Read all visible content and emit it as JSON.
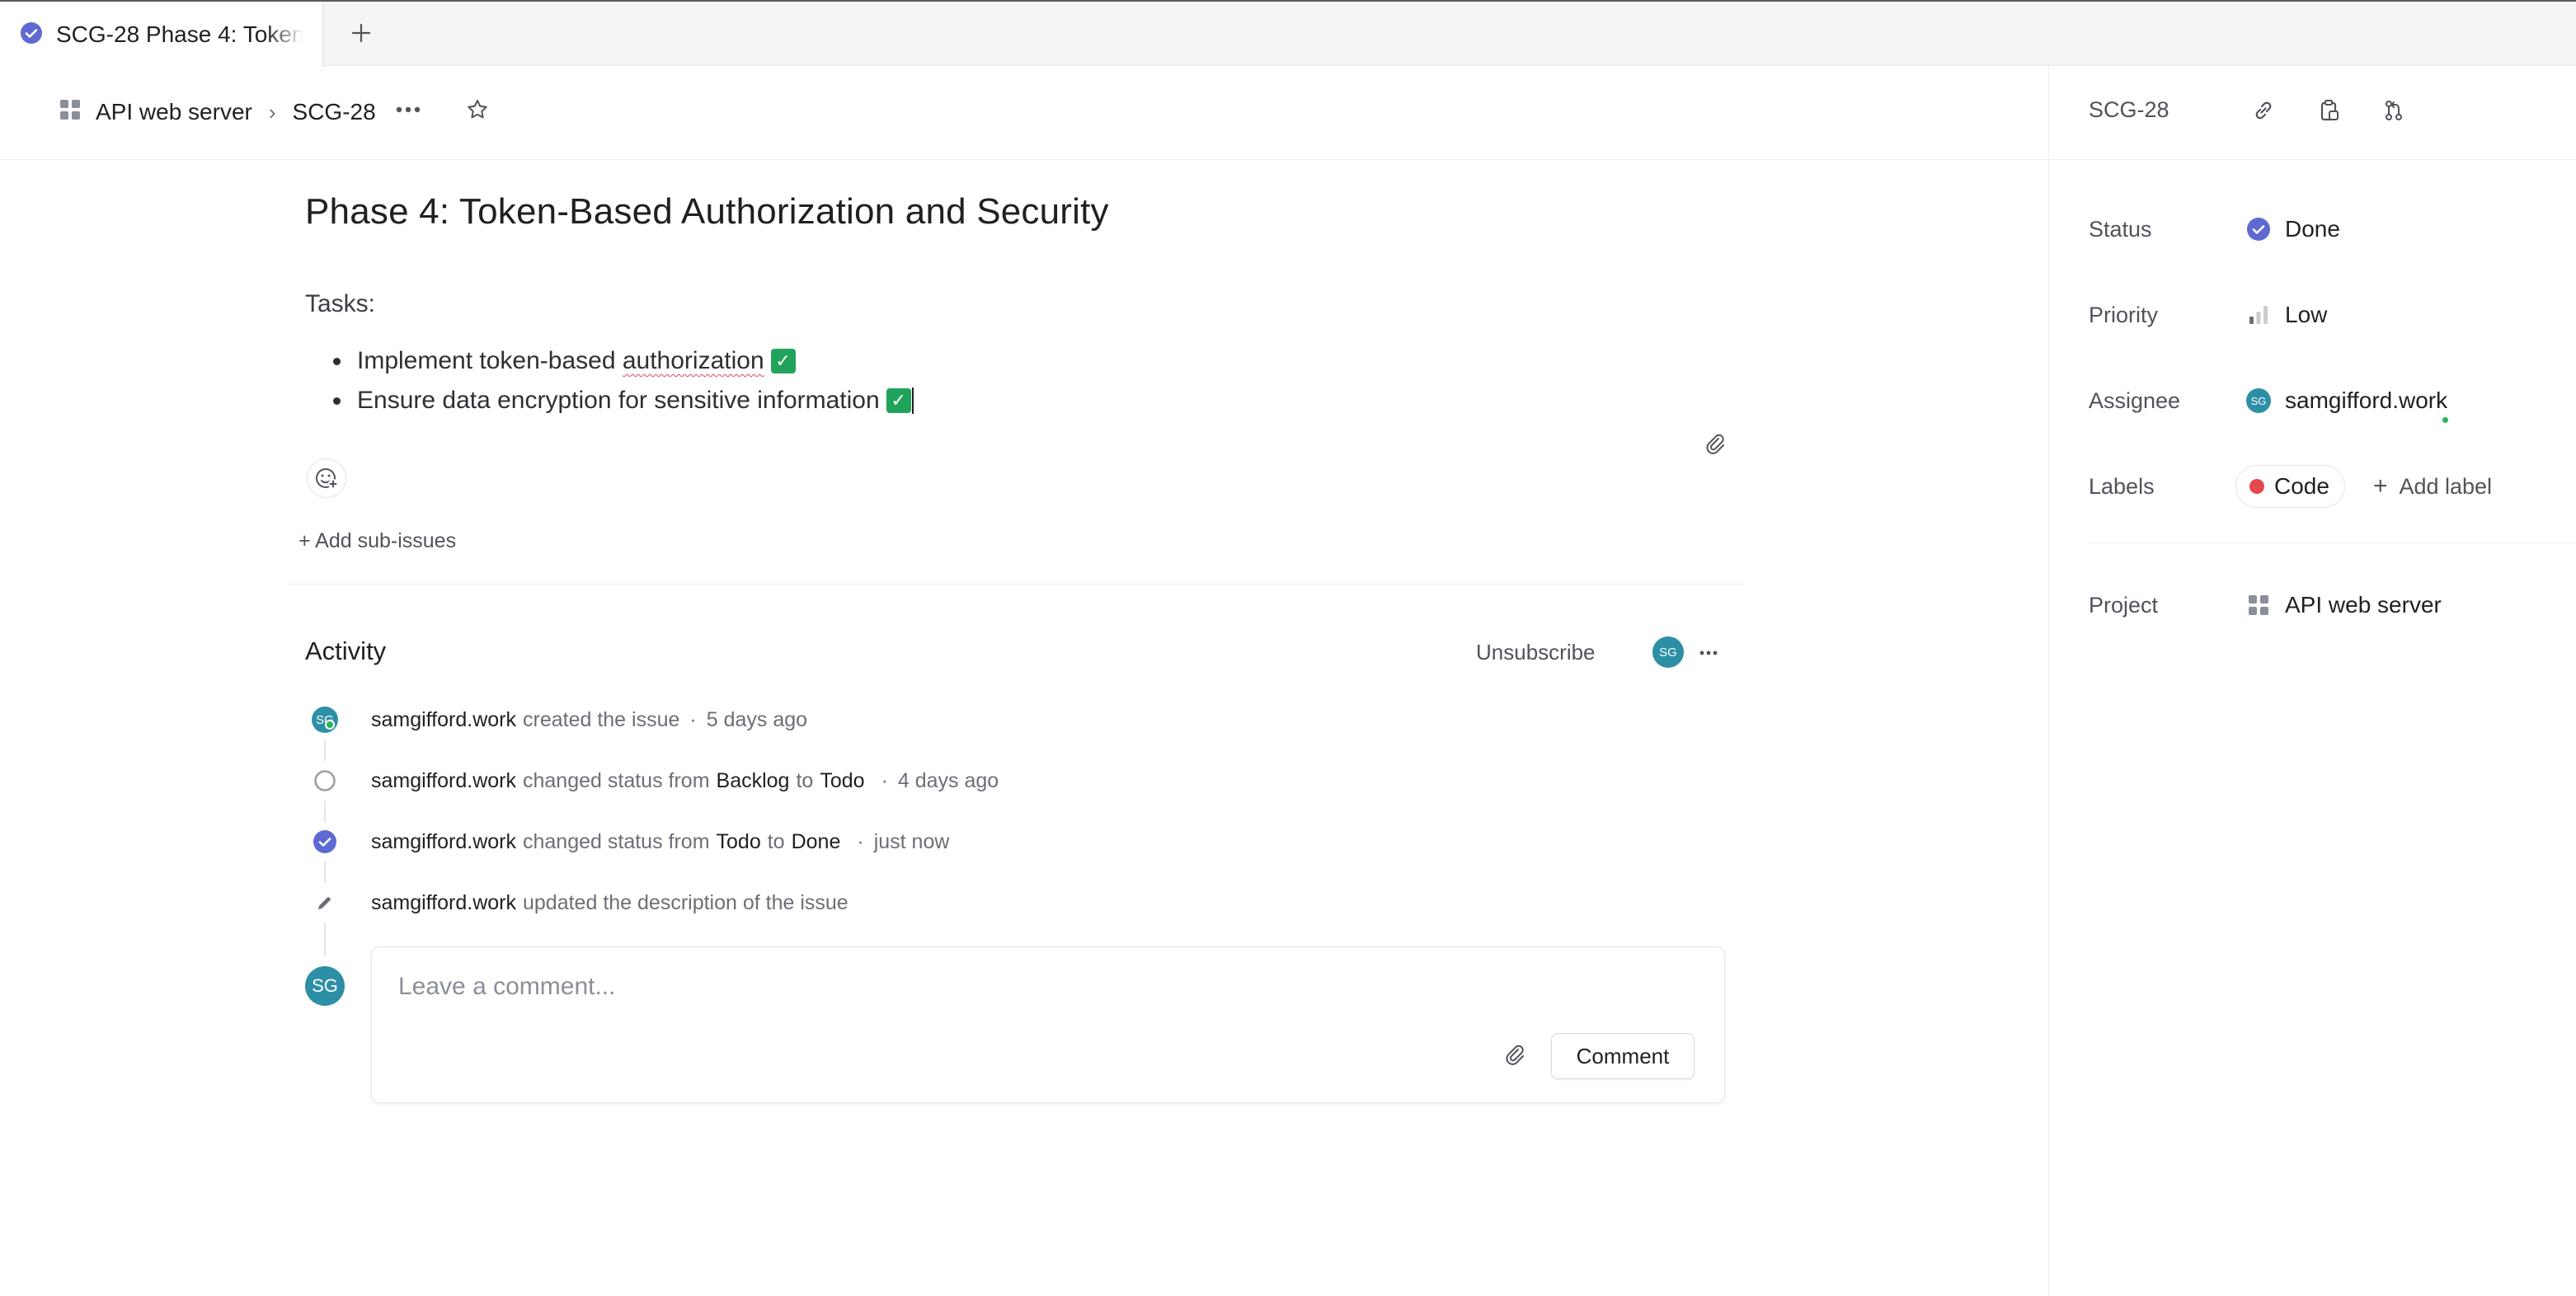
{
  "tab": {
    "title": "SCG-28 Phase 4: Token-Based Authorization and Security",
    "new_tab_symbol": "+"
  },
  "header": {
    "project": "API web server",
    "separator": "›",
    "issue_id": "SCG-28"
  },
  "issue": {
    "title": "Phase 4: Token-Based Authorization and Security",
    "description_label": "Tasks:",
    "tasks": [
      {
        "prefix": "Implement token-based ",
        "underlined": "authorization",
        "done": "✓"
      },
      {
        "text": "Ensure data encryption for sensitive information",
        "done": "✓"
      }
    ],
    "add_sub_issues": "+ Add sub-issues"
  },
  "activity": {
    "title": "Activity",
    "unsubscribe": "Unsubscribe",
    "subscriber_initials": "SG",
    "events": [
      {
        "actor": "samgifford.work",
        "text": "created the issue",
        "sep": "·",
        "time": "5 days ago",
        "avatar": "SG"
      },
      {
        "actor": "samgifford.work",
        "text": "changed status from",
        "from": "Backlog",
        "to_word": "to",
        "to": "Todo",
        "sep": "·",
        "time": "4 days ago"
      },
      {
        "actor": "samgifford.work",
        "text": "changed status from",
        "from": "Todo",
        "to_word": "to",
        "to": "Done",
        "sep": "·",
        "time": "just now"
      },
      {
        "actor": "samgifford.work",
        "text": "updated the description of the issue"
      }
    ],
    "comment": {
      "avatar": "SG",
      "placeholder": "Leave a comment...",
      "button": "Comment"
    }
  },
  "sidebar": {
    "issue_id": "SCG-28",
    "status": {
      "label": "Status",
      "value": "Done"
    },
    "priority": {
      "label": "Priority",
      "value": "Low"
    },
    "assignee": {
      "label": "Assignee",
      "value": "samgifford.work",
      "initials": "SG"
    },
    "labels": {
      "label": "Labels",
      "chip": "Code",
      "chip_color": "#e5484d",
      "add": "Add label",
      "add_symbol": "+"
    },
    "project": {
      "label": "Project",
      "value": "API web server"
    }
  },
  "colors": {
    "accent": "#5e6ad2",
    "avatar": "#2d8fa6",
    "online": "#2bb55a",
    "check": "#22a35c"
  }
}
